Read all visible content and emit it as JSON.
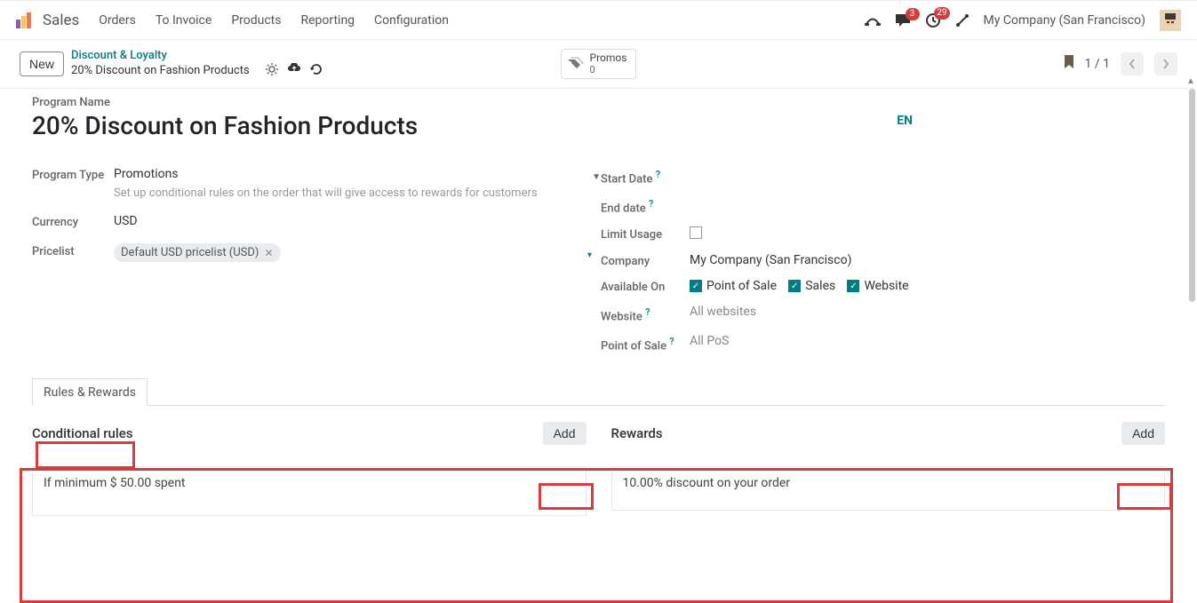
{
  "topbar": {
    "brand": "Sales",
    "menu": [
      "Orders",
      "To Invoice",
      "Products",
      "Reporting",
      "Configuration"
    ],
    "badge_messages": "3",
    "badge_activities": "29",
    "company": "My Company (San Francisco)"
  },
  "controlbar": {
    "new_label": "New",
    "breadcrumb_parent": "Discount & Loyalty",
    "breadcrumb_current": "20% Discount on Fashion Products",
    "filter_tag_label": "Promos",
    "filter_tag_count": "0",
    "page_info": "1 / 1"
  },
  "form": {
    "program_name_label": "Program Name",
    "program_name_value": "20% Discount on Fashion Products",
    "lang_badge": "EN",
    "program_type_label": "Program Type",
    "program_type_value": "Promotions",
    "program_type_help": "Set up conditional rules on the order that will give access to rewards for customers",
    "currency_label": "Currency",
    "currency_value": "USD",
    "pricelist_label": "Pricelist",
    "pricelist_tag": "Default USD pricelist (USD)",
    "start_date_label": "Start Date",
    "end_date_label": "End date",
    "limit_usage_label": "Limit Usage",
    "company_label": "Company",
    "company_value": "My Company (San Francisco)",
    "available_on_label": "Available On",
    "available_on_pos": "Point of Sale",
    "available_on_sales": "Sales",
    "available_on_website": "Website",
    "website_label": "Website",
    "website_value": "All websites",
    "pos_label": "Point of Sale",
    "pos_value": "All PoS"
  },
  "tabs": {
    "rules_rewards": "Rules & Rewards"
  },
  "rules": {
    "cond_title": "Conditional rules",
    "add_label": "Add",
    "cond_item": "If minimum $ 50.00 spent",
    "rewards_title": "Rewards",
    "rewards_item": "10.00% discount on your order"
  }
}
